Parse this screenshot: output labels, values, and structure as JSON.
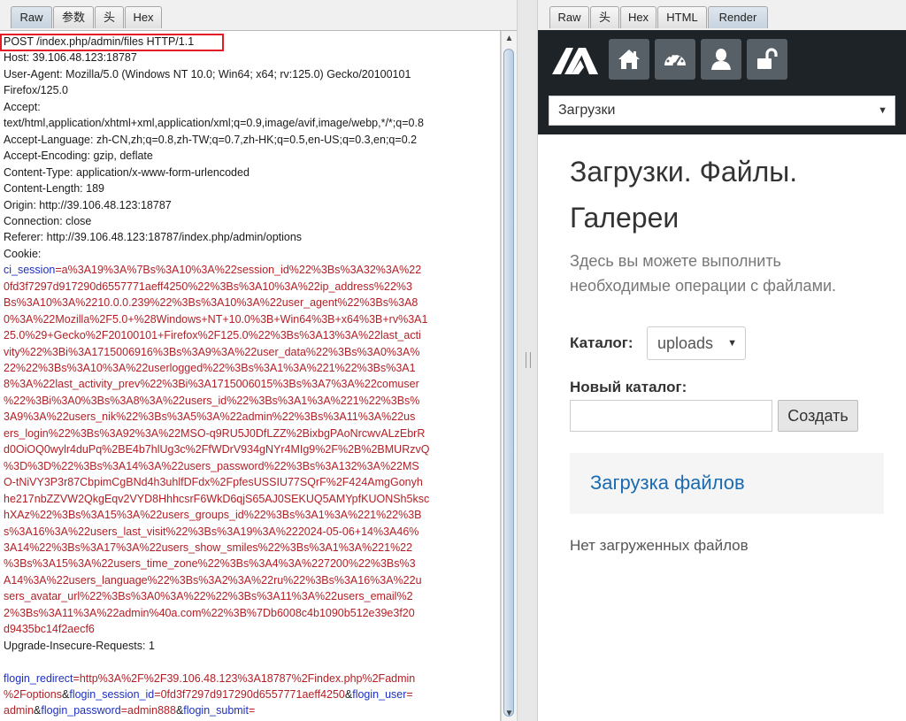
{
  "left_tabs": [
    "Raw",
    "参数",
    "头",
    "Hex"
  ],
  "right_tabs": [
    "Raw",
    "头",
    "Hex",
    "HTML",
    "Render"
  ],
  "request": {
    "request_line": "POST /index.php/admin/files HTTP/1.1",
    "headers": [
      "Host: 39.106.48.123:18787",
      "User-Agent: Mozilla/5.0 (Windows NT 10.0; Win64; x64; rv:125.0) Gecko/20100101",
      "Firefox/125.0",
      "Accept:",
      "text/html,application/xhtml+xml,application/xml;q=0.9,image/avif,image/webp,*/*;q=0.8",
      "Accept-Language: zh-CN,zh;q=0.8,zh-TW;q=0.7,zh-HK;q=0.5,en-US;q=0.3,en;q=0.2",
      "Accept-Encoding: gzip, deflate",
      "Content-Type: application/x-www-form-urlencoded",
      "Content-Length: 189",
      "Origin: http://39.106.48.123:18787",
      "Connection: close",
      "Referer: http://39.106.48.123:18787/index.php/admin/options",
      "Cookie:"
    ],
    "cookie_name": "ci_session",
    "cookie_first": "=a%3A19%3A%7Bs%3A10%3A%22session_id%22%3Bs%3A32%3A%22",
    "cookie_lines": [
      "0fd3f7297d917290d6557771aeff4250%22%3Bs%3A10%3A%22ip_address%22%3",
      "Bs%3A10%3A%2210.0.0.239%22%3Bs%3A10%3A%22user_agent%22%3Bs%3A8",
      "0%3A%22Mozilla%2F5.0+%28Windows+NT+10.0%3B+Win64%3B+x64%3B+rv%3A1",
      "25.0%29+Gecko%2F20100101+Firefox%2F125.0%22%3Bs%3A13%3A%22last_acti",
      "vity%22%3Bi%3A1715006916%3Bs%3A9%3A%22user_data%22%3Bs%3A0%3A%",
      "22%22%3Bs%3A10%3A%22userlogged%22%3Bs%3A1%3A%221%22%3Bs%3A1",
      "8%3A%22last_activity_prev%22%3Bi%3A1715006015%3Bs%3A7%3A%22comuser",
      "%22%3Bi%3A0%3Bs%3A8%3A%22users_id%22%3Bs%3A1%3A%221%22%3Bs%",
      "3A9%3A%22users_nik%22%3Bs%3A5%3A%22admin%22%3Bs%3A11%3A%22us",
      "ers_login%22%3Bs%3A92%3A%22MSO-q9RU5J0DfLZZ%2BixbgPAoNrcwvALzEbrR",
      "d0OiOQ0wylr4duPq%2BE4b7hlUg3c%2FfWDrV934gNYr4MIg9%2F%2B%2BMURzvQ",
      "%3D%3D%22%3Bs%3A14%3A%22users_password%22%3Bs%3A132%3A%22MS",
      "O-tNiVY3P3r87CbpimCgBNd4h3uhlfDFdx%2FpfesUSSIU77SQrF%2F424AmgGonyh",
      "he217nbZZVW2QkgEqv2VYD8HhhcsrF6WkD6qjS65AJ0SEKUQ5AMYpfKUONSh5ksc",
      "hXAz%22%3Bs%3A15%3A%22users_groups_id%22%3Bs%3A1%3A%221%22%3B",
      "s%3A16%3A%22users_last_visit%22%3Bs%3A19%3A%222024-05-06+14%3A46%",
      "3A14%22%3Bs%3A17%3A%22users_show_smiles%22%3Bs%3A1%3A%221%22",
      "%3Bs%3A15%3A%22users_time_zone%22%3Bs%3A4%3A%227200%22%3Bs%3",
      "A14%3A%22users_language%22%3Bs%3A2%3A%22ru%22%3Bs%3A16%3A%22u",
      "sers_avatar_url%22%3Bs%3A0%3A%22%22%3Bs%3A11%3A%22users_email%2",
      "2%3Bs%3A11%3A%22admin%40a.com%22%3B%7Db6008c4b1090b512e39e3f20",
      "d9435bc14f2aecf6"
    ],
    "upgrade_header": "Upgrade-Insecure-Requests: 1",
    "body": {
      "p1_key": "flogin_redirect",
      "p1_val": "=http%3A%2F%2F39.106.48.123%3A18787%2Findex.php%2Fadmin",
      "p1_val_cont": "%2Foptions",
      "amp": "&",
      "p2_key": "flogin_session_id",
      "p2_val": "=0fd3f7297d917290d6557771aeff4250",
      "p3_key": "flogin_user",
      "p3_val": "=",
      "p3_val_cont": "admin",
      "p4_key": "flogin_password",
      "p4_val": "=admin888",
      "p5_key": "flogin_submit",
      "p5_val": "="
    }
  },
  "render": {
    "nav_select": "Загрузки",
    "title_line1": "Загрузки. Файлы.",
    "title_line2": "Галереи",
    "lead_line1": "Здесь вы можете выполнить",
    "lead_line2": "необходимые операции с файлами.",
    "catalog_label": "Каталог:",
    "catalog_value": "uploads",
    "new_catalog_label": "Новый каталог:",
    "create_button": "Создать",
    "upload_panel_title": "Загрузка файлов",
    "no_files": "Нет загруженных файлов"
  },
  "icons": [
    "logo-icon",
    "home-icon",
    "dashboard-icon",
    "user-icon",
    "unlock-icon"
  ],
  "colors": {
    "highlight": "#e21b24",
    "key": "#1d2fbf",
    "value": "#b31f25",
    "navbar": "#1d2327"
  }
}
